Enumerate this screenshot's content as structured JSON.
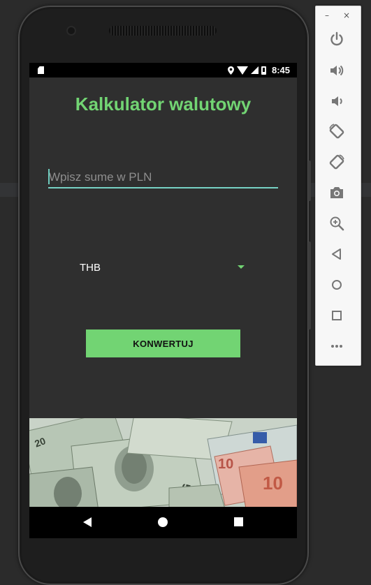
{
  "status_bar": {
    "time": "8:45"
  },
  "app": {
    "title": "Kalkulator walutowy",
    "amount_input": {
      "value": "",
      "placeholder": "Wpisz sume w PLN"
    },
    "currency_spinner": {
      "selected": "THB"
    },
    "convert_button": "KONWERTUJ"
  },
  "emulator_toolbar": {
    "minimize": "–",
    "close": "×",
    "buttons": [
      "power-icon",
      "volume-up-icon",
      "volume-down-icon",
      "rotate-left-icon",
      "rotate-right-icon",
      "camera-icon",
      "zoom-icon",
      "back-icon",
      "home-icon",
      "overview-icon",
      "more-icon"
    ]
  },
  "colors": {
    "accent": "#72d473",
    "input_underline": "#77d2c5",
    "screen_bg": "#2f2f2f"
  }
}
